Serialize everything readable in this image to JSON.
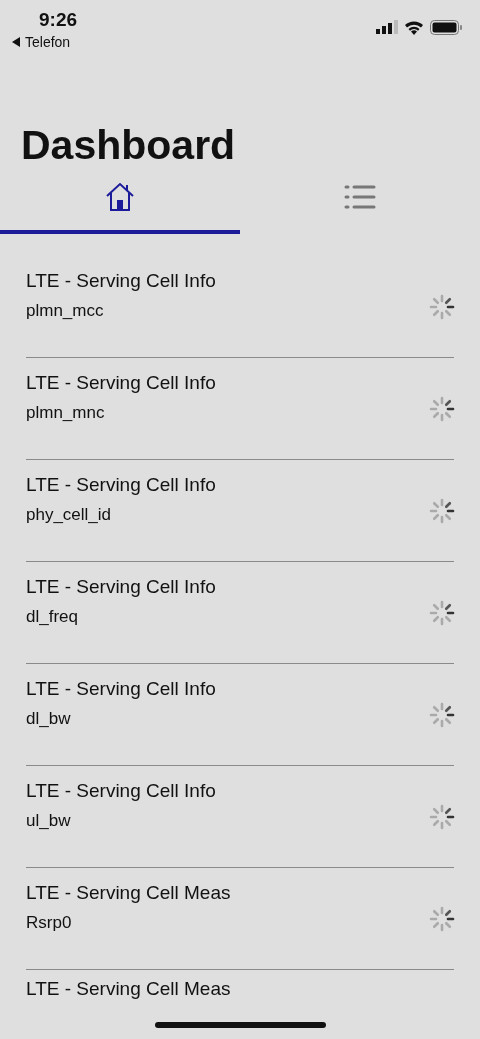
{
  "status_bar": {
    "time": "9:26",
    "back_label": "Telefon"
  },
  "title": "Dashboard",
  "tabs": [
    {
      "kind": "home",
      "selected": true
    },
    {
      "kind": "list",
      "selected": false
    }
  ],
  "items": [
    {
      "title": "LTE - Serving Cell Info",
      "field": "plmn_mcc"
    },
    {
      "title": "LTE - Serving Cell Info",
      "field": "plmn_mnc"
    },
    {
      "title": "LTE - Serving Cell Info",
      "field": "phy_cell_id"
    },
    {
      "title": "LTE - Serving Cell Info",
      "field": "dl_freq"
    },
    {
      "title": "LTE - Serving Cell Info",
      "field": "dl_bw"
    },
    {
      "title": "LTE - Serving Cell Info",
      "field": "ul_bw"
    },
    {
      "title": "LTE - Serving Cell Meas",
      "field": "Rsrp0"
    }
  ],
  "cut_item": {
    "title": "LTE - Serving Cell Meas"
  }
}
